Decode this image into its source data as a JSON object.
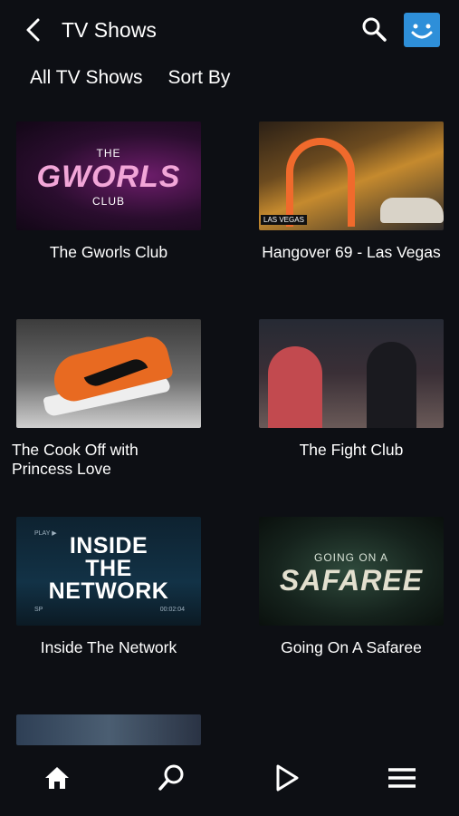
{
  "header": {
    "title": "TV Shows",
    "back_icon": "chevron-left-icon",
    "search_icon": "search-icon",
    "avatar_icon": "smiley-avatar-icon",
    "avatar_color": "#2e8fd9"
  },
  "filters": {
    "all": "All TV Shows",
    "sort": "Sort By"
  },
  "shows": [
    {
      "title": "The Gworls Club",
      "thumb_small_top": "THE",
      "thumb_big": "GWORLS",
      "thumb_small_bottom": "CLUB"
    },
    {
      "title": "Hangover 69 - Las Vegas",
      "thumb_tag": "LAS VEGAS"
    },
    {
      "title": "The Cook Off with Princess Love"
    },
    {
      "title": "The Fight Club"
    },
    {
      "title": "Inside The Network",
      "thumb_line1": "INSIDE",
      "thumb_line2": "THE",
      "thumb_line3": "NETWORK",
      "thumb_corner_tl": "PLAY ▶",
      "thumb_corner_bl": "SP",
      "thumb_corner_br": "00:02:04"
    },
    {
      "title": "Going On A Safaree",
      "thumb_line1": "GOING ON A",
      "thumb_line2": "SAFAREE"
    }
  ],
  "bottom_nav": {
    "home_icon": "home-icon",
    "search_icon": "search-icon",
    "play_icon": "play-icon",
    "menu_icon": "hamburger-menu-icon"
  },
  "colors": {
    "background": "#0d0f14",
    "accent": "#2e8fd9"
  }
}
